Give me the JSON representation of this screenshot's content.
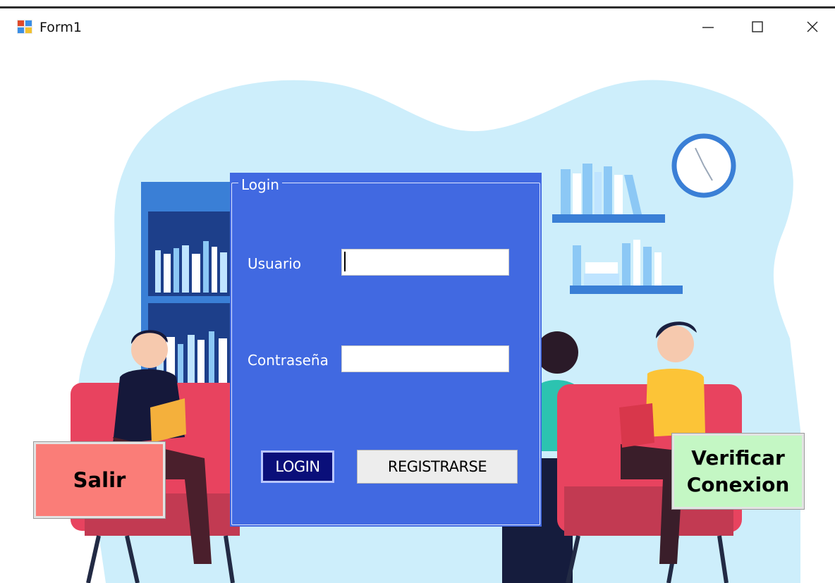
{
  "window": {
    "title": "Form1",
    "icon": "windows-forms-app-icon",
    "controls": [
      "minimize-icon",
      "maximize-icon",
      "close-icon"
    ]
  },
  "login_group": {
    "legend": "Login",
    "background": "#4169e1",
    "usuario_label": "Usuario",
    "usuario_value": "",
    "contrasena_label": "Contraseña",
    "contrasena_value": ""
  },
  "buttons": {
    "login_label": "LOGIN",
    "login_color": "#0a0f7a",
    "registrarse_label": "REGISTRARSE",
    "salir_label": "Salir",
    "salir_color": "#fa7d78",
    "verificar_line1": "Verificar",
    "verificar_line2": "Conexion",
    "verificar_color": "#c4f7c4"
  }
}
